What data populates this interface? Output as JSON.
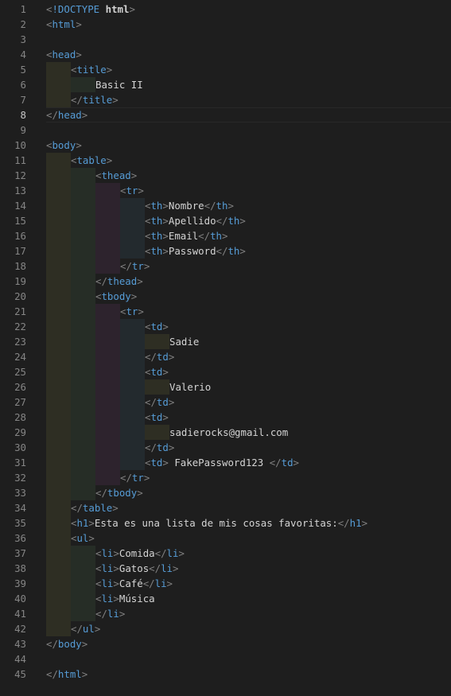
{
  "editor": {
    "current_line": 8,
    "lines": [
      {
        "n": "1",
        "indent": 0,
        "code": "<!DOCTYPE html>"
      },
      {
        "n": "2",
        "indent": 0,
        "code": "<html>"
      },
      {
        "n": "3",
        "indent": 0,
        "code": ""
      },
      {
        "n": "4",
        "indent": 0,
        "code": "<head>"
      },
      {
        "n": "5",
        "indent": 1,
        "code": "<title>"
      },
      {
        "n": "6",
        "indent": 2,
        "code": "Basic II"
      },
      {
        "n": "7",
        "indent": 1,
        "code": "</title>"
      },
      {
        "n": "8",
        "indent": 0,
        "code": "</head>"
      },
      {
        "n": "9",
        "indent": 0,
        "code": ""
      },
      {
        "n": "10",
        "indent": 0,
        "code": "<body>"
      },
      {
        "n": "11",
        "indent": 1,
        "code": "<table>"
      },
      {
        "n": "12",
        "indent": 2,
        "code": "<thead>"
      },
      {
        "n": "13",
        "indent": 3,
        "code": "<tr>"
      },
      {
        "n": "14",
        "indent": 4,
        "code": "<th>Nombre</th>"
      },
      {
        "n": "15",
        "indent": 4,
        "code": "<th>Apellido</th>"
      },
      {
        "n": "16",
        "indent": 4,
        "code": "<th>Email</th>"
      },
      {
        "n": "17",
        "indent": 4,
        "code": "<th>Password</th>"
      },
      {
        "n": "18",
        "indent": 3,
        "code": "</tr>"
      },
      {
        "n": "19",
        "indent": 2,
        "code": "</thead>"
      },
      {
        "n": "20",
        "indent": 2,
        "code": "<tbody>"
      },
      {
        "n": "21",
        "indent": 3,
        "code": "<tr>"
      },
      {
        "n": "22",
        "indent": 4,
        "code": "<td>"
      },
      {
        "n": "23",
        "indent": 5,
        "code": "Sadie"
      },
      {
        "n": "24",
        "indent": 4,
        "code": "</td>"
      },
      {
        "n": "25",
        "indent": 4,
        "code": "<td>"
      },
      {
        "n": "26",
        "indent": 5,
        "code": "Valerio"
      },
      {
        "n": "27",
        "indent": 4,
        "code": "</td>"
      },
      {
        "n": "28",
        "indent": 4,
        "code": "<td>"
      },
      {
        "n": "29",
        "indent": 5,
        "code": "sadierocks@gmail.com"
      },
      {
        "n": "30",
        "indent": 4,
        "code": "</td>"
      },
      {
        "n": "31",
        "indent": 4,
        "code": "<td> FakePassword123 </td>"
      },
      {
        "n": "32",
        "indent": 3,
        "code": "</tr>"
      },
      {
        "n": "33",
        "indent": 2,
        "code": "</tbody>"
      },
      {
        "n": "34",
        "indent": 1,
        "code": "</table>"
      },
      {
        "n": "35",
        "indent": 1,
        "code": "<h1>Esta es una lista de mis cosas favoritas:</h1>"
      },
      {
        "n": "36",
        "indent": 1,
        "code": "<ul>"
      },
      {
        "n": "37",
        "indent": 2,
        "code": "<li>Comida</li>"
      },
      {
        "n": "38",
        "indent": 2,
        "code": "<li>Gatos</li>"
      },
      {
        "n": "39",
        "indent": 2,
        "code": "<li>Café</li>"
      },
      {
        "n": "40",
        "indent": 2,
        "code": "<li>Música"
      },
      {
        "n": "41",
        "indent": 2,
        "code": "</li>"
      },
      {
        "n": "42",
        "indent": 1,
        "code": "</ul>"
      },
      {
        "n": "43",
        "indent": 0,
        "code": "</body>"
      },
      {
        "n": "44",
        "indent": 0,
        "code": ""
      },
      {
        "n": "45",
        "indent": 0,
        "code": "</html>"
      }
    ]
  },
  "colors": {
    "background": "#1e1e1e",
    "line_number": "#858585",
    "tag_name": "#569cd6",
    "bracket": "#808080",
    "text": "#d4d4d4"
  }
}
